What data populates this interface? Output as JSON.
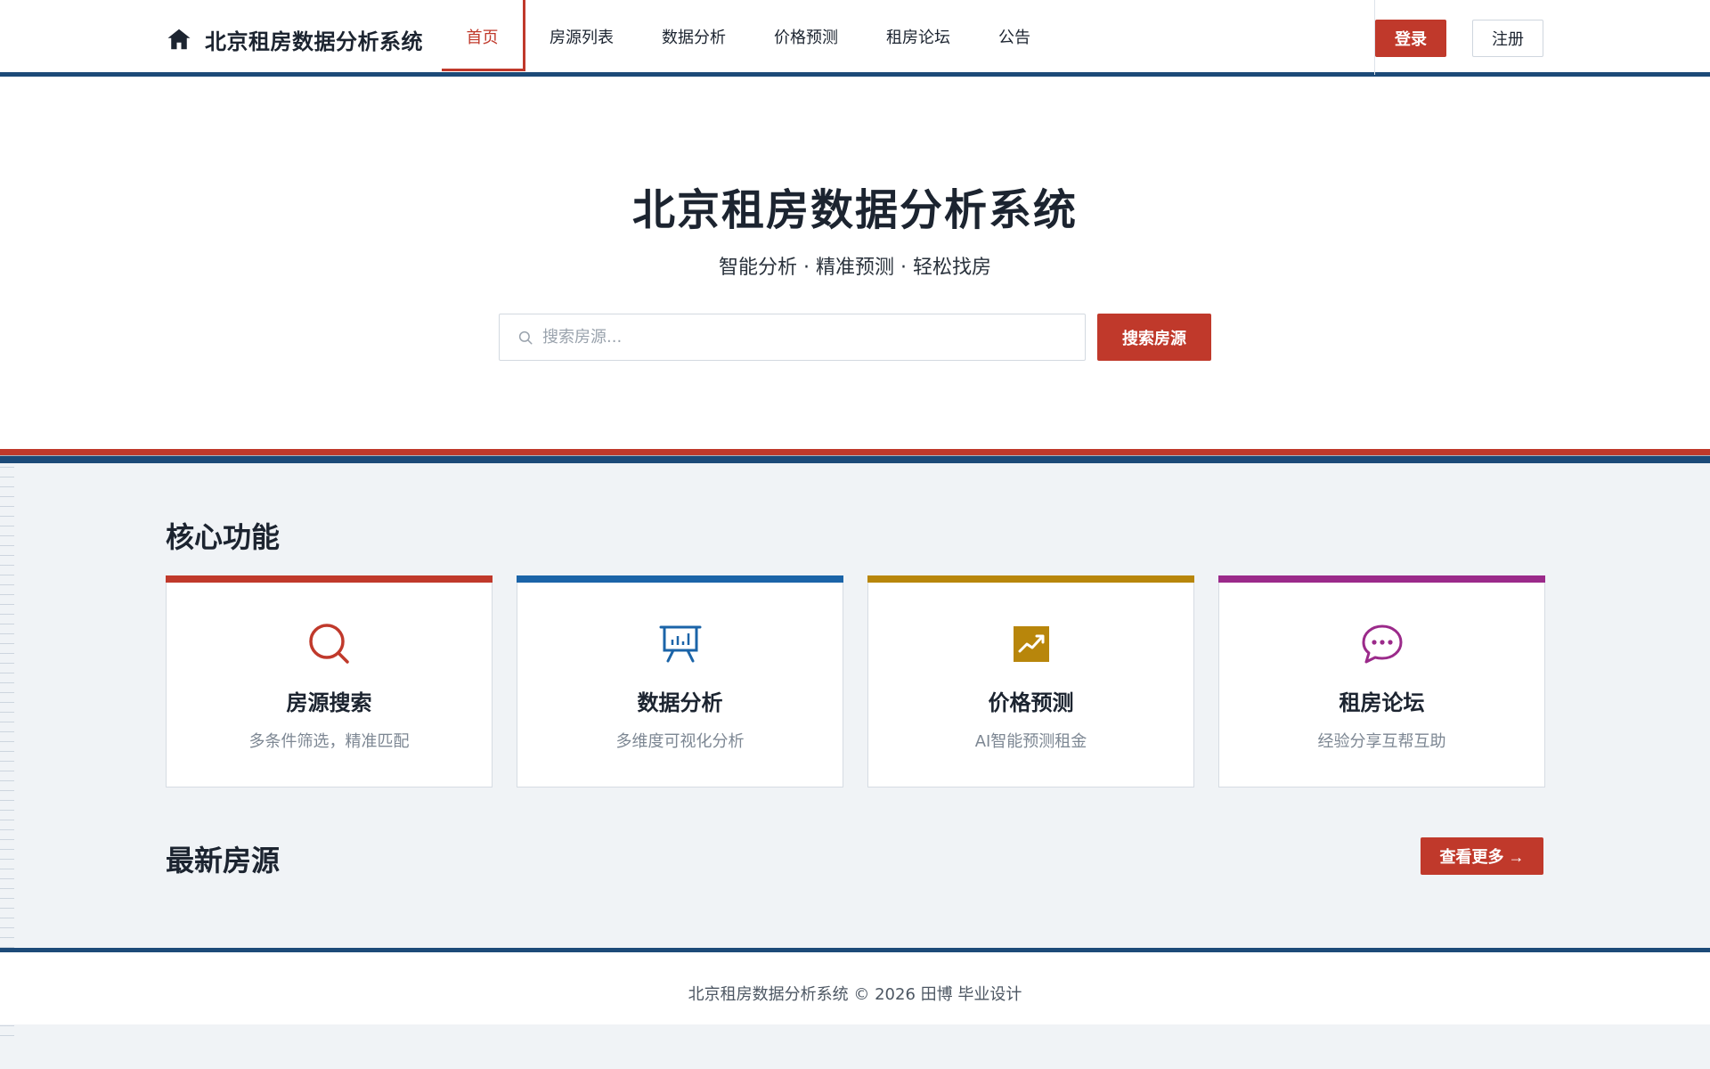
{
  "header": {
    "brand": "北京租房数据分析系统",
    "nav": [
      "首页",
      "房源列表",
      "数据分析",
      "价格预测",
      "租房论坛",
      "公告"
    ],
    "active_nav": "首页",
    "login_label": "登录",
    "register_label": "注册"
  },
  "hero": {
    "title": "北京租房数据分析系统",
    "subtitle": "智能分析 · 精准预测 · 轻松找房",
    "search_placeholder": "搜索房源...",
    "search_value": "",
    "search_button": "搜索房源"
  },
  "features": {
    "title": "核心功能",
    "cards": [
      {
        "title": "房源搜索",
        "desc": "多条件筛选，精准匹配",
        "icon": "search-icon",
        "color": "#c0392b"
      },
      {
        "title": "数据分析",
        "desc": "多维度可视化分析",
        "icon": "presentation-chart-icon",
        "color": "#1b64a8"
      },
      {
        "title": "价格预测",
        "desc": "AI智能预测租金",
        "icon": "trend-chart-icon",
        "color": "#b8860b"
      },
      {
        "title": "租房论坛",
        "desc": "经验分享互帮互助",
        "icon": "chat-bubble-icon",
        "color": "#9b2a8a"
      }
    ]
  },
  "latest": {
    "title": "最新房源",
    "more_label": "查看更多 →"
  },
  "footer": {
    "text": "北京租房数据分析系统 © 2026 田博 毕业设计"
  },
  "colors": {
    "accent": "#c0392b",
    "navy": "#1c4a78"
  }
}
